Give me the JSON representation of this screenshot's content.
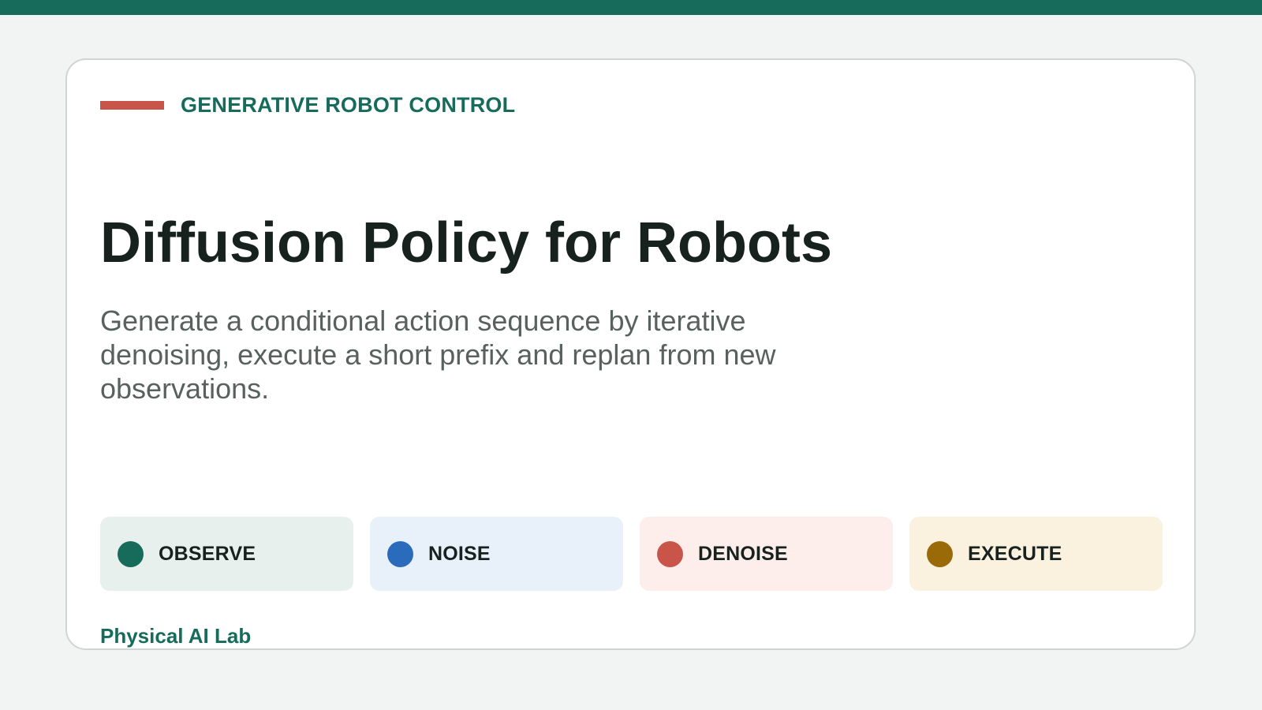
{
  "eyebrow": "GENERATIVE ROBOT CONTROL",
  "title": "Diffusion Policy for Robots",
  "subtitle": "Generate a conditional action sequence by iterative denoising, execute a short prefix and replan from new observations.",
  "steps": [
    {
      "label": "OBSERVE",
      "dot_color": "#176b5b",
      "bg_color": "#e7f0ed"
    },
    {
      "label": "NOISE",
      "dot_color": "#2b6bbb",
      "bg_color": "#e8f0fa"
    },
    {
      "label": "DENOISE",
      "dot_color": "#c9544a",
      "bg_color": "#fdeeeb"
    },
    {
      "label": "EXECUTE",
      "dot_color": "#9a6a08",
      "bg_color": "#faf1df"
    }
  ],
  "footer": "Physical AI Lab",
  "colors": {
    "accent": "#176b5b",
    "rule": "#c9544a",
    "background": "#f2f4f3"
  }
}
